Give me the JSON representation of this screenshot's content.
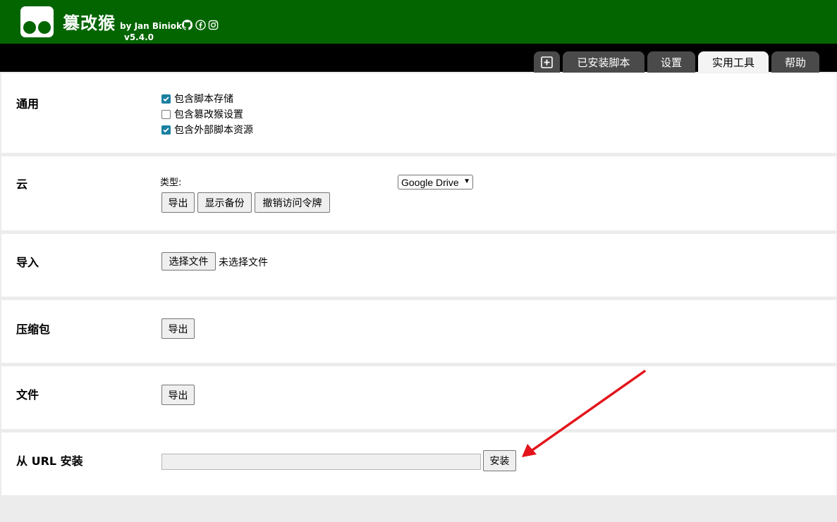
{
  "header": {
    "title": "篡改猴",
    "by": "by Jan Biniok",
    "version": "v5.4.0",
    "social_icons": [
      "github-icon",
      "facebook-icon",
      "instagram-icon"
    ],
    "bg_color": "#036500"
  },
  "tabs": [
    {
      "id": "new",
      "label": "",
      "icon": "plus-square-icon"
    },
    {
      "id": "installed",
      "label": "已安装脚本"
    },
    {
      "id": "settings",
      "label": "设置"
    },
    {
      "id": "utilities",
      "label": "实用工具",
      "active": true
    },
    {
      "id": "help",
      "label": "帮助"
    }
  ],
  "sections": {
    "general": {
      "title": "通用",
      "options": [
        {
          "label": "包含脚本存储",
          "checked": true
        },
        {
          "label": "包含篡改猴设置",
          "checked": false
        },
        {
          "label": "包含外部脚本资源",
          "checked": true
        }
      ]
    },
    "cloud": {
      "title": "云",
      "type_label": "类型:",
      "type_value": "Google Drive",
      "buttons": [
        "导出",
        "显示备份",
        "撤销访问令牌"
      ]
    },
    "import": {
      "title": "导入",
      "choose_button": "选择文件",
      "no_file": "未选择文件"
    },
    "zip": {
      "title": "压缩包",
      "export_button": "导出"
    },
    "file": {
      "title": "文件",
      "export_button": "导出"
    },
    "install_url": {
      "title": "从 URL 安装",
      "input_value": "",
      "install_button": "安装"
    }
  },
  "colors": {
    "accent": "#036500",
    "checkbox": "#1a7fa0",
    "annotation_arrow": "#e3141b"
  }
}
